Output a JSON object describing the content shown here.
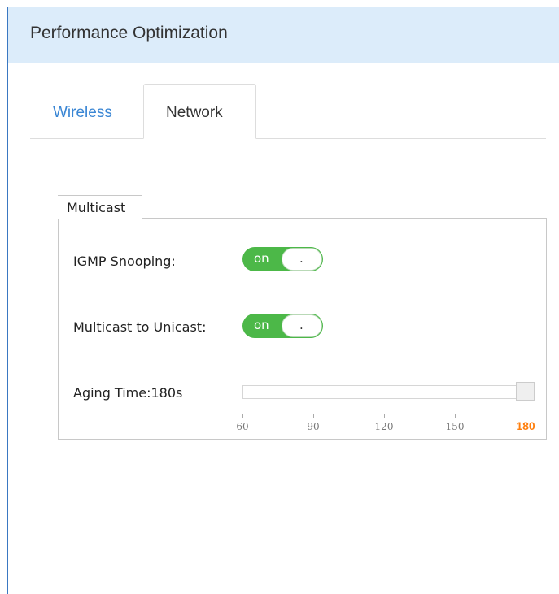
{
  "header": {
    "title": "Performance Optimization"
  },
  "tabs": [
    {
      "label": "Wireless",
      "active": false
    },
    {
      "label": "Network",
      "active": true
    }
  ],
  "multicast": {
    "legend": "Multicast",
    "igmp": {
      "label": "IGMP Snooping:",
      "state": "on",
      "knob": "."
    },
    "m2u": {
      "label": "Multicast to Unicast:",
      "state": "on",
      "knob": "."
    },
    "aging": {
      "label": "Aging Time:180s",
      "value": 180,
      "min": 60,
      "max": 180,
      "ticks": [
        "60",
        "90",
        "120",
        "150",
        "180"
      ]
    }
  },
  "colors": {
    "accent": "#4cb848",
    "header_bg": "#dcecfa",
    "link": "#3a86d4",
    "highlight": "#ff7f0e"
  }
}
